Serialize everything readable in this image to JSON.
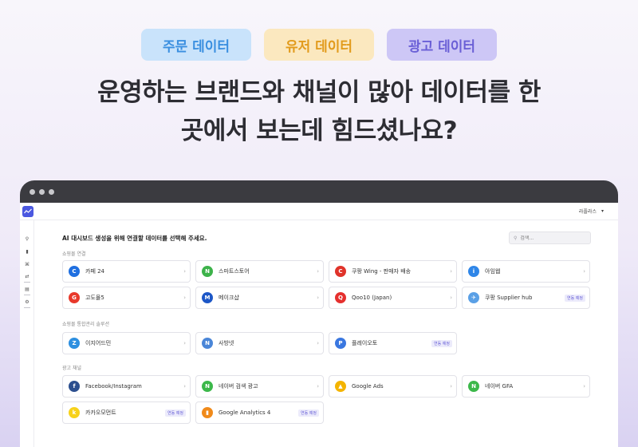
{
  "tags": [
    "주문 데이터",
    "유저 데이터",
    "광고 데이터"
  ],
  "headline": {
    "line1": "운영하는 브랜드와 채널이 많아 데이터를 한",
    "line2": "곳에서 보는데 힘드셨나요?"
  },
  "app": {
    "user_name": "라플라스",
    "page_title": "AI 대시보드 생성을 위해 연결할 데이터를 선택해 주세요.",
    "search": {
      "placeholder": "검색..."
    },
    "sections": [
      {
        "label": "쇼핑몰 연결",
        "cards": [
          {
            "name": "카페 24",
            "icon": "cafe24-logo",
            "color": "#1f6fe0",
            "glyph": "C"
          },
          {
            "name": "스마트스토어",
            "icon": "smartstore-logo",
            "color": "#3db24a",
            "glyph": "N"
          },
          {
            "name": "쿠팡 Wing - 판매자 배송",
            "icon": "coupang-wing-logo",
            "color": "#e0332a",
            "glyph": "C"
          },
          {
            "name": "아임웹",
            "icon": "imweb-logo",
            "color": "#2f86e8",
            "glyph": "i"
          },
          {
            "name": "고도몰5",
            "icon": "godomall-logo",
            "color": "#e8392c",
            "glyph": "G"
          },
          {
            "name": "메이크샵",
            "icon": "makeshop-logo",
            "color": "#1d57c7",
            "glyph": "M"
          },
          {
            "name": "Qoo10 (Japan)",
            "icon": "qoo10-logo",
            "color": "#e5302e",
            "glyph": "Q"
          },
          {
            "name": "쿠팡 Supplier hub",
            "icon": "coupang-supplier-logo",
            "color": "#5aa0e6",
            "glyph": "✈",
            "badge": "연동 예정"
          }
        ]
      },
      {
        "label": "쇼핑몰 통합관리 솔루션",
        "cards": [
          {
            "name": "이지어드민",
            "icon": "ezadmin-logo",
            "color": "#2d8fe0",
            "glyph": "Z"
          },
          {
            "name": "사방넷",
            "icon": "sabangnet-logo",
            "color": "#4a86d8",
            "glyph": "N"
          },
          {
            "name": "플레이오토",
            "icon": "playauto-logo",
            "color": "#3a77e0",
            "glyph": "P",
            "badge": "연동 예정"
          }
        ]
      },
      {
        "label": "광고 채널",
        "cards": [
          {
            "name": "Facebook/Instagram",
            "icon": "facebook-logo",
            "color": "#2c4f8f",
            "glyph": "f"
          },
          {
            "name": "네이버 검색 광고",
            "icon": "naver-search-ad-logo",
            "color": "#3cb84a",
            "glyph": "N"
          },
          {
            "name": "Google Ads",
            "icon": "google-ads-logo",
            "color": "#f4b400",
            "glyph": "▲"
          },
          {
            "name": "네이버 GFA",
            "icon": "naver-gfa-logo",
            "color": "#3cb84a",
            "glyph": "N"
          },
          {
            "name": "카카오모먼트",
            "icon": "kakao-moment-logo",
            "color": "#f7d21a",
            "glyph": "k",
            "badge": "연동 예정"
          },
          {
            "name": "Google Analytics 4",
            "icon": "google-analytics-logo",
            "color": "#f08a1a",
            "glyph": "▮",
            "badge": "연동 예정"
          }
        ]
      }
    ]
  }
}
